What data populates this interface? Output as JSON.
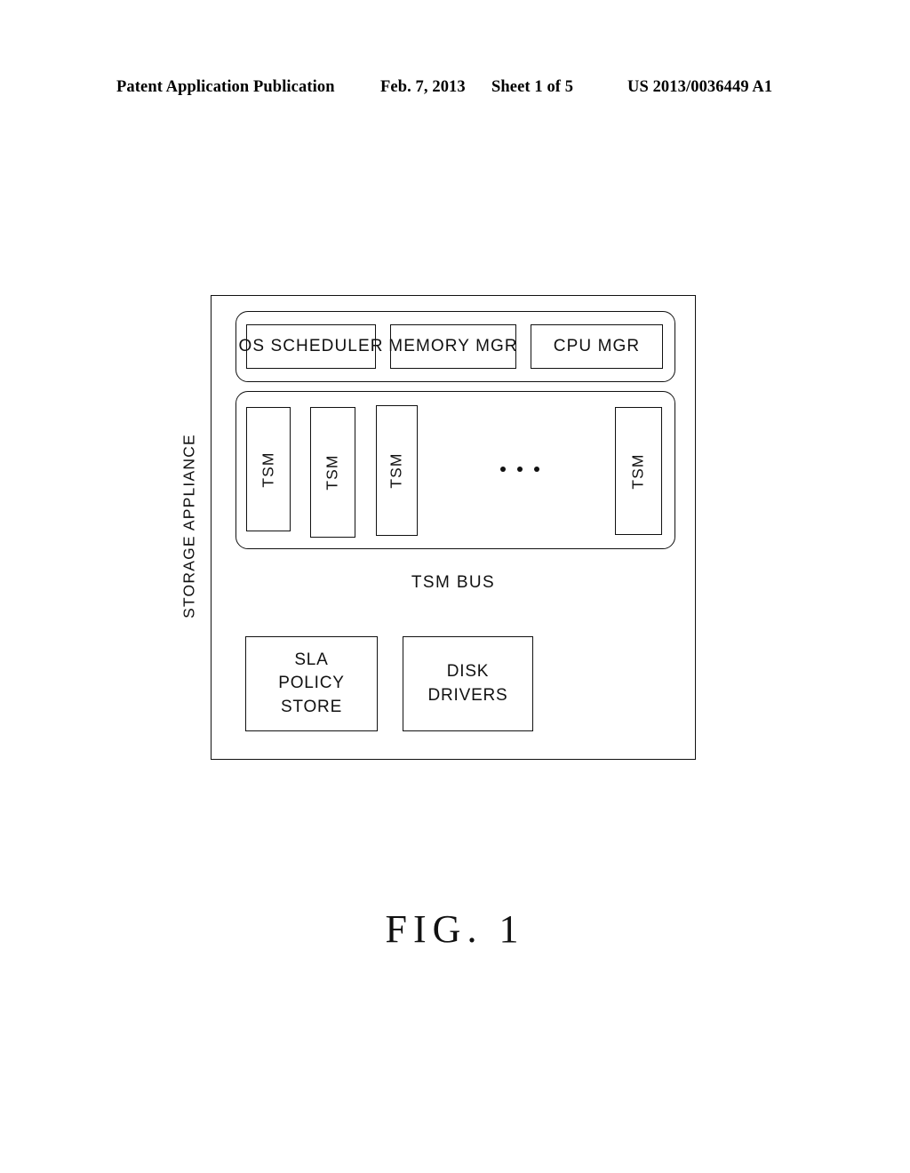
{
  "header": {
    "publication": "Patent Application Publication",
    "date": "Feb. 7, 2013",
    "sheet": "Sheet 1 of 5",
    "patent_number": "US 2013/0036449 A1"
  },
  "figure": {
    "caption": "FIG. 1",
    "outer_label": "STORAGE APPLIANCE",
    "bus_label": "TSM BUS",
    "manager_row": [
      {
        "label": "OS SCHEDULER"
      },
      {
        "label": "MEMORY MGR"
      },
      {
        "label": "CPU MGR"
      }
    ],
    "tsm_row": [
      {
        "label": "TSM"
      },
      {
        "label": "TSM"
      },
      {
        "label": "TSM"
      },
      {
        "label": "TSM"
      }
    ],
    "tsm_ellipsis": "• • •",
    "bottom_row": [
      {
        "line1": "SLA",
        "line2": "POLICY",
        "line3": "STORE"
      },
      {
        "line1": "DISK",
        "line2": "DRIVERS",
        "line3": ""
      }
    ]
  },
  "colors": {
    "ink": "#111111",
    "paper": "#ffffff"
  }
}
